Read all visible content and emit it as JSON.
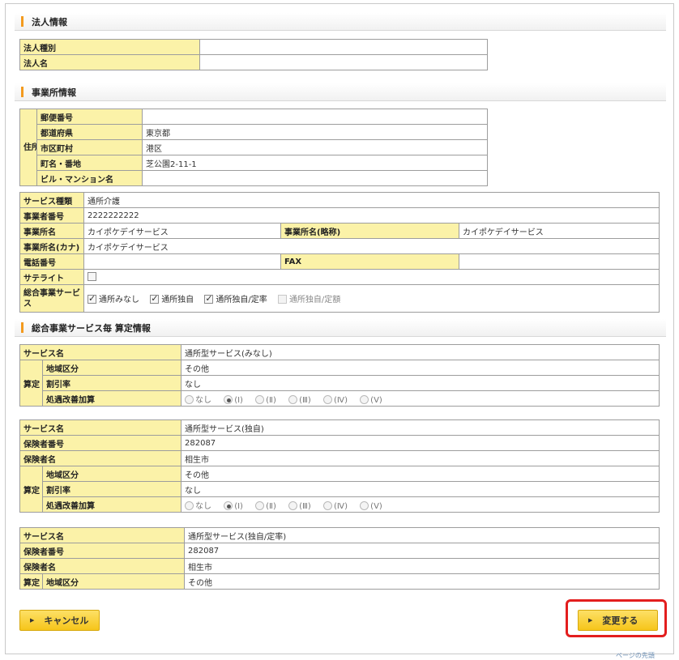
{
  "corp": {
    "heading": "法人情報",
    "type_label": "法人種別",
    "type_value": "",
    "name_label": "法人名",
    "name_value": ""
  },
  "office": {
    "heading": "事業所情報",
    "address_group_label": "住所",
    "postal_label": "郵便番号",
    "postal_value": "",
    "pref_label": "都道府県",
    "pref_value": "東京都",
    "city_label": "市区町村",
    "city_value": "港区",
    "street_label": "町名・番地",
    "street_value": "芝公園2-11-1",
    "building_label": "ビル・マンション名",
    "building_value": "",
    "service_type_label": "サービス種類",
    "service_type_value": "通所介護",
    "provider_no_label": "事業者番号",
    "provider_no_value": "2222222222",
    "office_name_label": "事業所名",
    "office_name_value": "カイポケデイサービス",
    "short_name_label": "事業所名(略称)",
    "short_name_value": "カイポケデイサービス",
    "kana_label": "事業所名(カナ)",
    "kana_value": "カイポケデイサービス",
    "phone_label": "電話番号",
    "phone_value": "",
    "fax_label": "FAX",
    "fax_value": "",
    "satellite_label": "サテライト",
    "satellite_checked": false,
    "comprehensive_label": "総合事業サービス",
    "comprehensive_options": [
      {
        "label": "通所みなし",
        "checked": true,
        "disabled": false
      },
      {
        "label": "通所独自",
        "checked": true,
        "disabled": false
      },
      {
        "label": "通所独自/定率",
        "checked": true,
        "disabled": false
      },
      {
        "label": "通所独自/定額",
        "checked": false,
        "disabled": true
      }
    ]
  },
  "calc": {
    "heading": "総合事業サービス毎 算定情報",
    "san_label": "算定",
    "service_name_label": "サービス名",
    "insurer_no_label": "保険者番号",
    "insurer_name_label": "保険者名",
    "region_label": "地域区分",
    "discount_label": "割引率",
    "treatment_label": "処遇改善加算",
    "treatment_options": [
      "なし",
      "(Ⅰ)",
      "(Ⅱ)",
      "(Ⅲ)",
      "(Ⅳ)",
      "(Ⅴ)"
    ],
    "blocks": [
      {
        "service_name": "通所型サービス(みなし)",
        "region": "その他",
        "discount": "なし",
        "treatment_selected": 1
      },
      {
        "service_name": "通所型サービス(独自)",
        "insurer_no": "282087",
        "insurer_name": "相生市",
        "region": "その他",
        "discount": "なし",
        "treatment_selected": 1
      },
      {
        "service_name": "通所型サービス(独自/定率)",
        "insurer_no": "282087",
        "insurer_name": "相生市",
        "region": "その他"
      }
    ]
  },
  "buttons": {
    "cancel": "キャンセル",
    "submit": "変更する"
  },
  "footer_fragment": "ページの先頭"
}
